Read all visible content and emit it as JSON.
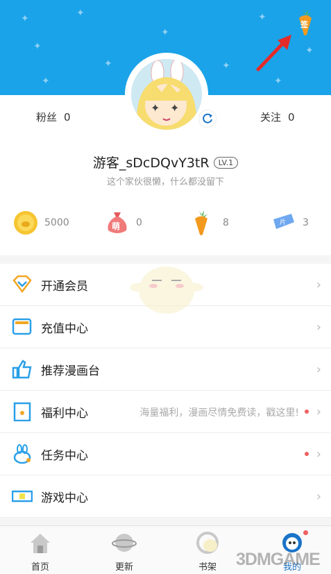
{
  "profile": {
    "fans_label": "粉丝",
    "fans_count": "0",
    "follow_label": "关注",
    "follow_count": "0",
    "username": "游客_sDcDQvY3tR",
    "level": "LV.1",
    "bio": "这个家伙很懒，什么都没留下"
  },
  "checkin_icon_text": "签",
  "currencies": [
    {
      "icon": "coin-icon",
      "value": "5000"
    },
    {
      "icon": "meng-bag-icon",
      "icon_text": "萌",
      "value": "0"
    },
    {
      "icon": "carrot-icon",
      "value": "8"
    },
    {
      "icon": "ticket-icon",
      "icon_text": "片",
      "value": "3"
    }
  ],
  "menu": [
    {
      "icon": "vip-diamond-icon",
      "label": "开通会员",
      "hint": "",
      "dot": false
    },
    {
      "icon": "wallet-icon",
      "label": "充值中心",
      "hint": "",
      "dot": false
    },
    {
      "icon": "thumbs-up-icon",
      "label": "推荐漫画台",
      "hint": "",
      "dot": false
    },
    {
      "icon": "gift-envelope-icon",
      "label": "福利中心",
      "hint": "海量福利，漫画尽情免费读，戳这里!",
      "dot": true
    },
    {
      "icon": "rabbit-icon",
      "label": "任务中心",
      "hint": "",
      "dot": true
    },
    {
      "icon": "game-ticket-icon",
      "label": "游戏中心",
      "hint": "",
      "dot": false
    }
  ],
  "nav": [
    {
      "icon": "home-icon",
      "label": "首页"
    },
    {
      "icon": "planet-icon",
      "label": "更新"
    },
    {
      "icon": "bookshelf-icon",
      "label": "书架"
    },
    {
      "icon": "mine-icon",
      "label": "我的"
    }
  ],
  "watermark": "3DMGAME",
  "colors": {
    "header_blue": "#1aa3e8",
    "alert_red": "#f06060",
    "arrow_red": "#e52a2a",
    "carrot_orange": "#f39a1e"
  }
}
